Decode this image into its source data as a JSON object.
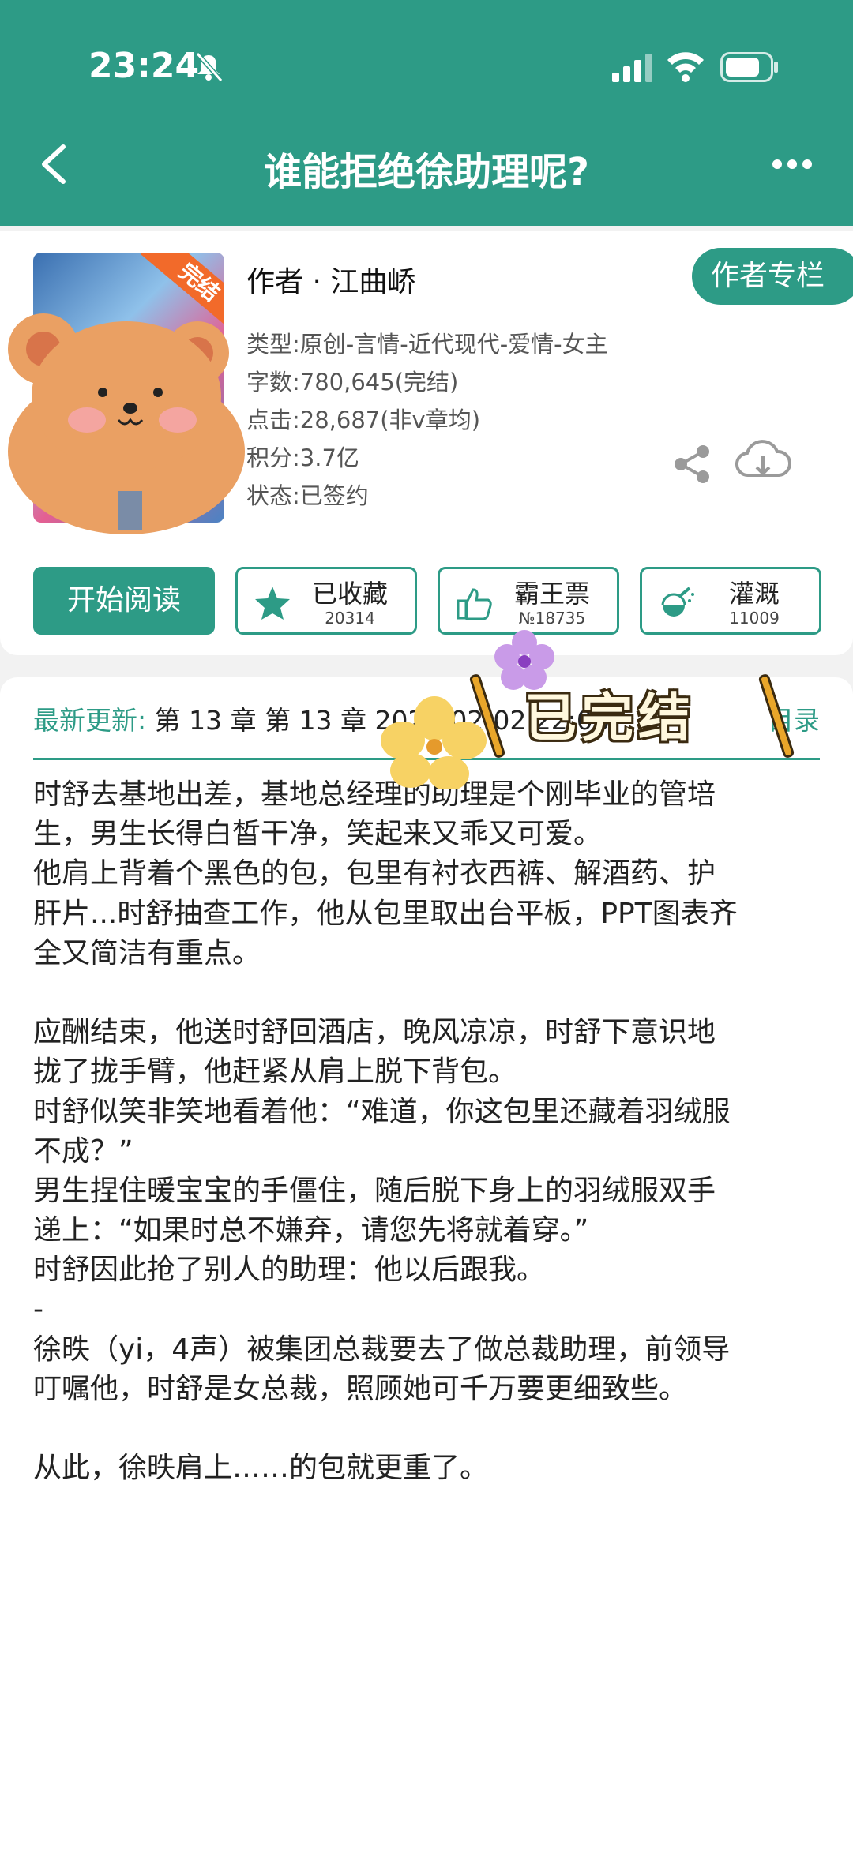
{
  "status_bar": {
    "time": "23:24"
  },
  "nav": {
    "title": "谁能拒绝徐助理呢?"
  },
  "book": {
    "cover_badge": "完结",
    "author_line": "作者 · 江曲峤",
    "author_column_label": "作者专栏",
    "meta": [
      "类型:原创-言情-近代现代-爱情-女主",
      "字数:780,645(完结)",
      "点击:28,687(非v章均)",
      "积分:3.7亿",
      "状态:已签约"
    ]
  },
  "actions": {
    "read_label": "开始阅读",
    "collect_label": "已收藏",
    "collect_count": "20314",
    "ticket_label": "霸王票",
    "ticket_rank": "№18735",
    "water_label": "灌溉",
    "water_count": "11009"
  },
  "latest": {
    "label": "最新更新:",
    "text": " 第 13 章  第 13 章 2026-02-02 22:06",
    "toc_label": "目录"
  },
  "sticker_text": "已完结",
  "synopsis": [
    "时舒去基地出差，基地总经理的助理是个刚毕业的管培",
    "生，男生长得白皙干净，笑起来又乖又可爱。",
    "他肩上背着个黑色的包，包里有衬衣西裤、解酒药、护",
    "肝片...时舒抽查工作，他从包里取出台平板，PPT图表齐",
    "全又简洁有重点。",
    "",
    "应酬结束，他送时舒回酒店，晚风凉凉，时舒下意识地",
    "拢了拢手臂，他赶紧从肩上脱下背包。",
    "时舒似笑非笑地看着他：“难道，你这包里还藏着羽绒服",
    "不成？”",
    "男生捏住暖宝宝的手僵住，随后脱下身上的羽绒服双手",
    "递上：“如果时总不嫌弃，请您先将就着穿。”",
    "时舒因此抢了别人的助理：他以后跟我。",
    "-",
    "徐昳（yi，4声）被集团总裁要去了做总裁助理，前领导",
    "叮嘱他，时舒是女总裁，照顾她可千万要更细致些。",
    "",
    "从此，徐昳肩上……的包就更重了。"
  ],
  "colors": {
    "accent": "#2d9b86",
    "bear": "#eaa063"
  }
}
